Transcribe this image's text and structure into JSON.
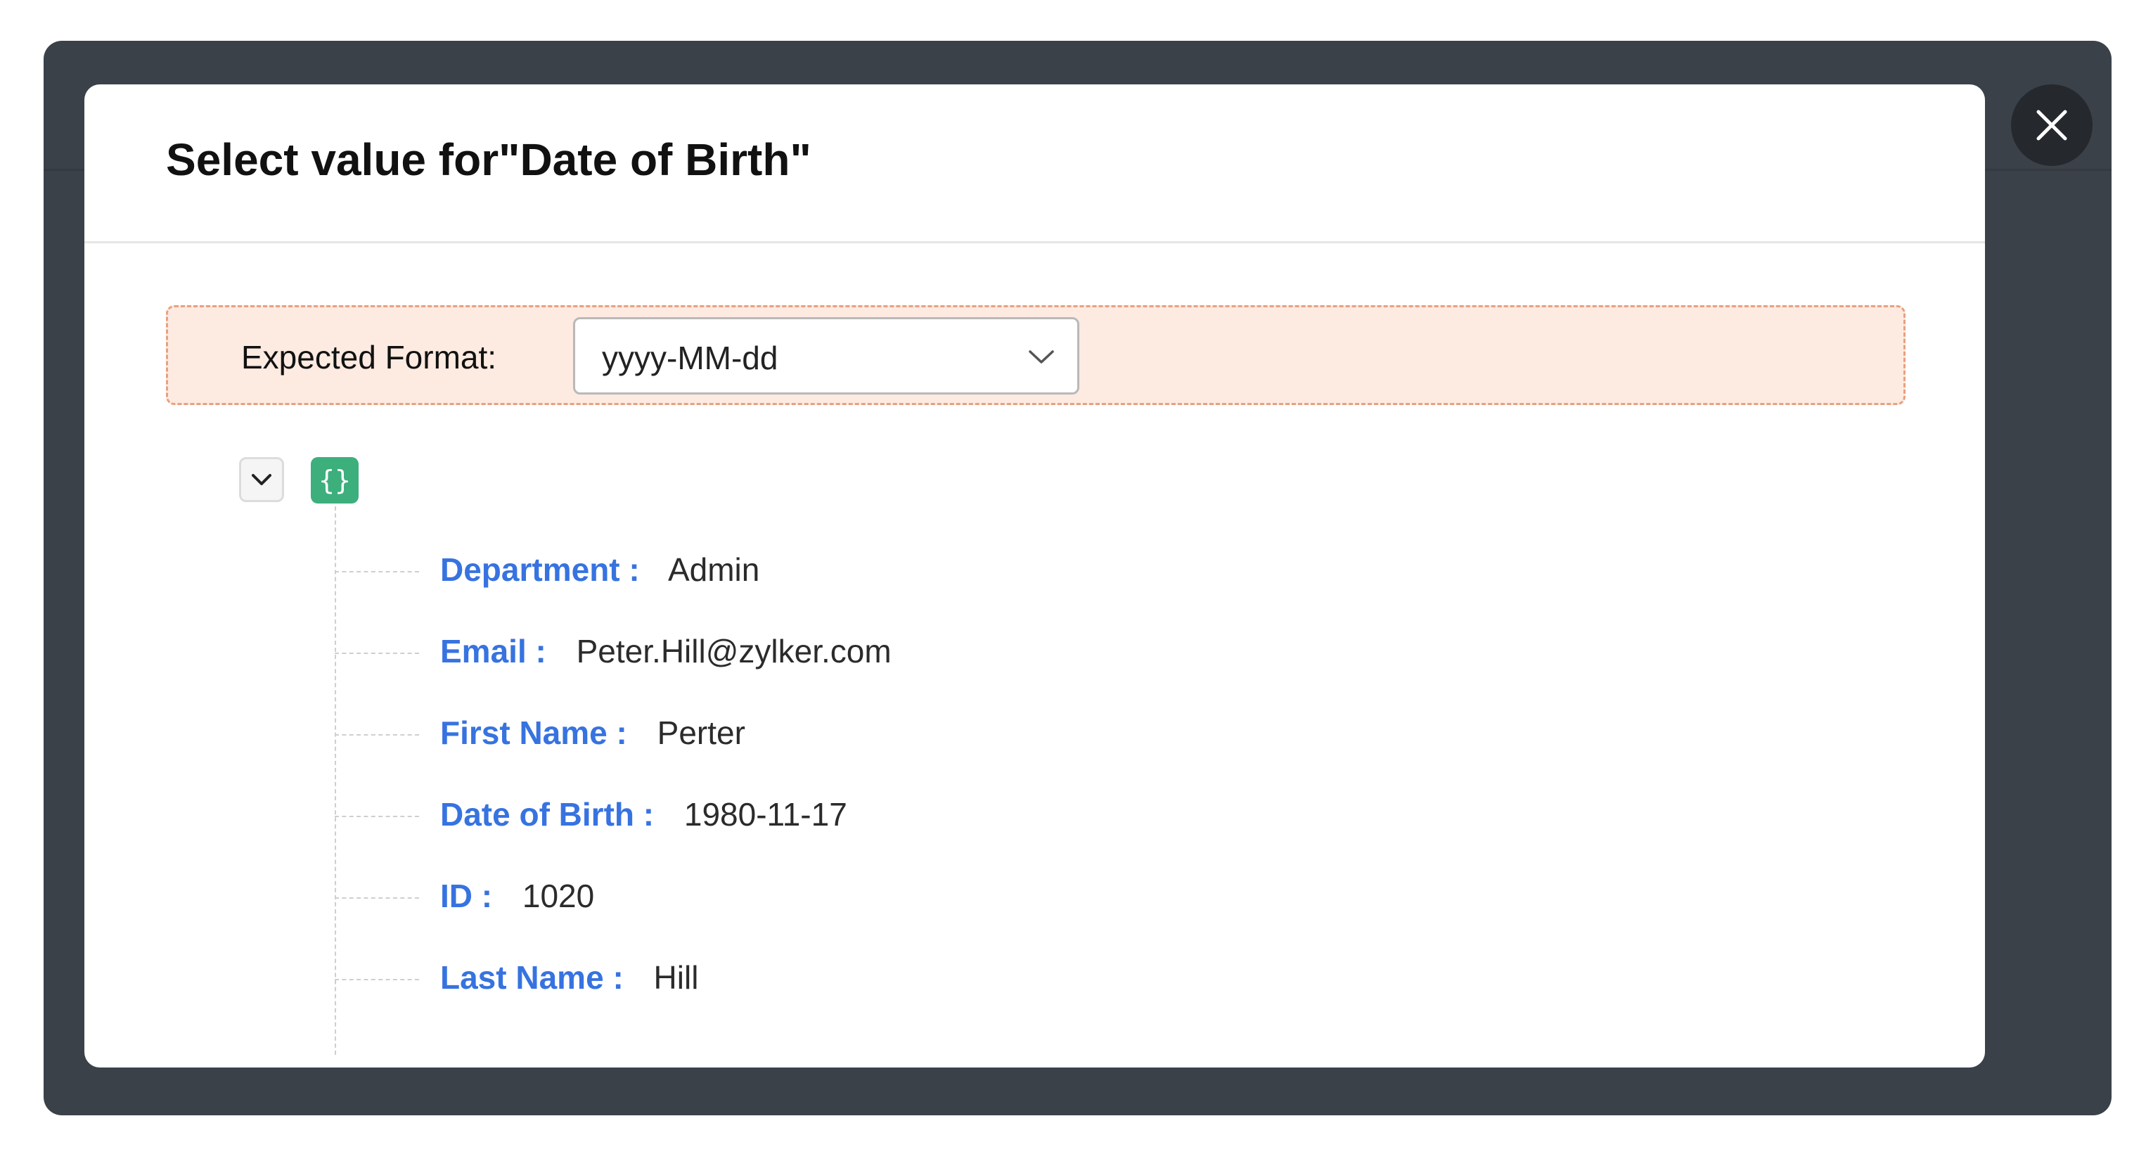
{
  "modal": {
    "title": "Select value for\"Date of Birth\"",
    "format": {
      "label": "Expected Format:",
      "selected": "yyyy-MM-dd"
    },
    "fields": [
      {
        "key": "Department",
        "value": "Admin"
      },
      {
        "key": "Email",
        "value": "Peter.Hill@zylker.com"
      },
      {
        "key": "First Name",
        "value": "Perter"
      },
      {
        "key": "Date of Birth",
        "value": "1980-11-17"
      },
      {
        "key": "ID",
        "value": "1020"
      },
      {
        "key": "Last Name",
        "value": "Hill"
      }
    ],
    "separator": ":",
    "object_badge": "{}"
  },
  "icons": {
    "close": "close-icon",
    "expand": "chevron-down-icon",
    "select": "chevron-down-icon"
  },
  "colors": {
    "backdrop": "#3b4149",
    "key_text": "#3773e0",
    "object_badge": "#3daf7d",
    "format_bar_bg": "#fdeae1",
    "format_bar_border": "#e8a07e"
  }
}
